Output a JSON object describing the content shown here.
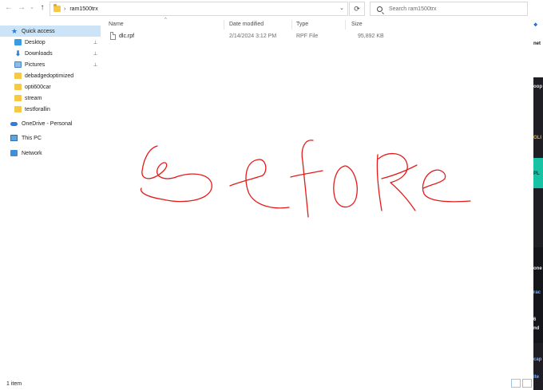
{
  "toolbar": {
    "back_icon": "←",
    "forward_icon": "→",
    "recent_icon": "⌄",
    "up_icon": "↑",
    "breadcrumb_chevron": "›",
    "breadcrumb": "ram1500trx",
    "dropdown_icon": "⌄",
    "refresh_icon": "⟳",
    "search_placeholder": "Search ram1500trx"
  },
  "sidebar": {
    "items": [
      {
        "label": "Quick access",
        "icon": "star-icon",
        "selected": true
      },
      {
        "label": "Desktop",
        "icon": "desktop-icon",
        "pinned": true
      },
      {
        "label": "Downloads",
        "icon": "download-icon",
        "pinned": true
      },
      {
        "label": "Pictures",
        "icon": "pictures-icon",
        "pinned": true
      },
      {
        "label": "debadgedoptimized",
        "icon": "folder-icon"
      },
      {
        "label": "opti600car",
        "icon": "folder-icon"
      },
      {
        "label": "stream",
        "icon": "folder-icon"
      },
      {
        "label": "testforallin",
        "icon": "folder-icon"
      },
      {
        "label": "OneDrive - Personal",
        "icon": "cloud-icon"
      },
      {
        "label": "This PC",
        "icon": "pc-icon"
      },
      {
        "label": "Network",
        "icon": "network-icon"
      }
    ],
    "pin_glyph": "📌"
  },
  "columns": {
    "name": "Name",
    "date": "Date modified",
    "type": "Type",
    "size": "Size",
    "sort_arrow": "^"
  },
  "files": [
    {
      "name": "dlc.rpf",
      "date": "2/14/2024 3:12 PM",
      "type": "RPF File",
      "size": "95,892 KB"
    }
  ],
  "status": {
    "count": "1 item"
  },
  "annotation": {
    "handwritten_text": "Before",
    "color": "#e31b1b"
  },
  "background_window": {
    "fragments": [
      "net",
      "oop",
      "OLI",
      "PL",
      "one",
      "rac",
      "6",
      "nd",
      "cap",
      "ite"
    ]
  },
  "colors": {
    "selection": "#cce4f7",
    "folder": "#f6c944",
    "accent": "#2a7ad1"
  }
}
